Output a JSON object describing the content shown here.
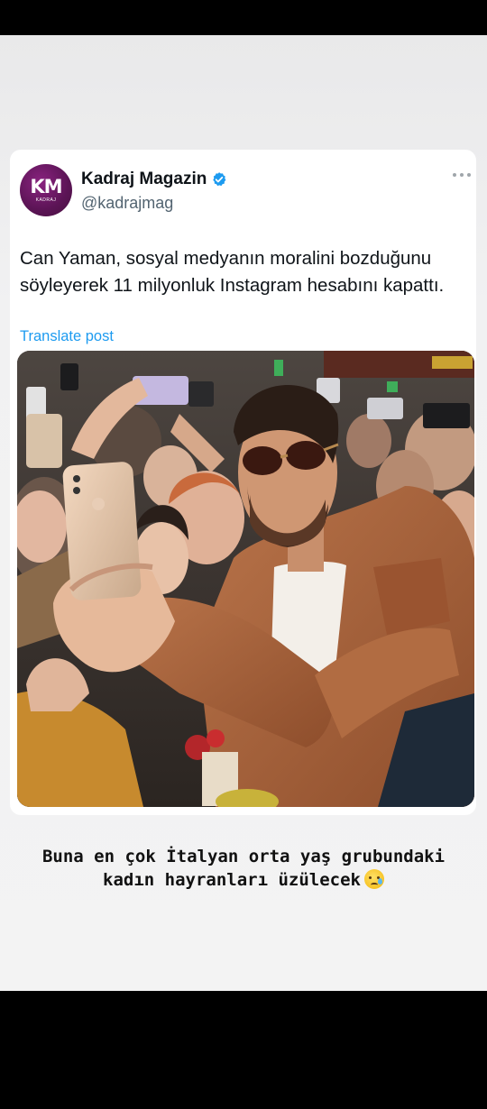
{
  "post": {
    "avatar_text": "KM",
    "avatar_subtext": "KADRAJ",
    "display_name": "Kadraj Magazin",
    "verified": true,
    "handle": "@kadrajmag",
    "text": "Can Yaman, sosyal medyanın moralini bozduğunu söyleyerek 11 milyonluk Instagram hesabını kapattı.",
    "translate_label": "Translate post",
    "image_description": "photo-selfie-crowd"
  },
  "story": {
    "caption_line1": "Buna en çok İtalyan orta yaş grubundaki",
    "caption_line2": "kadın hayranları üzülecek",
    "caption_emoji": "sad-tear-emoji-icon"
  },
  "colors": {
    "accent": "#1d9bf0",
    "avatar_bg": "#5b1455",
    "text": "#0f1419",
    "muted": "#536471",
    "jacket": "#a8643a"
  }
}
